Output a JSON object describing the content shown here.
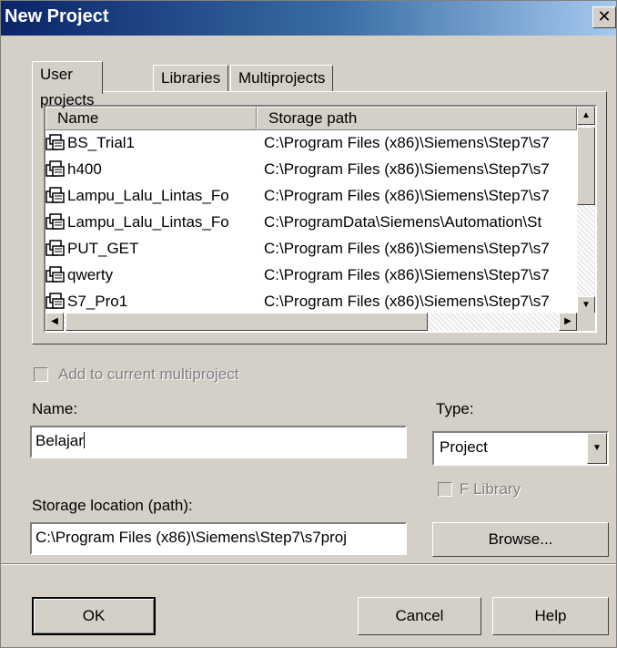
{
  "window": {
    "title": "New Project",
    "close_glyph": "✕"
  },
  "tabs": [
    {
      "label": "User projects",
      "active": true
    },
    {
      "label": "Libraries",
      "active": false
    },
    {
      "label": "Multiprojects",
      "active": false
    }
  ],
  "list": {
    "columns": [
      "Name",
      "Storage path"
    ],
    "rows": [
      {
        "name": "BS_Trial1",
        "path": "C:\\Program Files (x86)\\Siemens\\Step7\\s7"
      },
      {
        "name": "h400",
        "path": "C:\\Program Files (x86)\\Siemens\\Step7\\s7"
      },
      {
        "name": "Lampu_Lalu_Lintas_Fo",
        "path": "C:\\Program Files (x86)\\Siemens\\Step7\\s7"
      },
      {
        "name": "Lampu_Lalu_Lintas_Fo",
        "path": "C:\\ProgramData\\Siemens\\Automation\\St"
      },
      {
        "name": "PUT_GET",
        "path": "C:\\Program Files (x86)\\Siemens\\Step7\\s7"
      },
      {
        "name": "qwerty",
        "path": "C:\\Program Files (x86)\\Siemens\\Step7\\s7"
      },
      {
        "name": "S7_Pro1",
        "path": "C:\\Program Files (x86)\\Siemens\\Step7\\s7"
      }
    ],
    "icon": "project-icon"
  },
  "form": {
    "add_multiproject_label": "Add to current multiproject",
    "add_multiproject_checked": false,
    "name_label": "Name:",
    "name_value": "Belajar",
    "type_label": "Type:",
    "type_value": "Project",
    "flibrary_label": "F Library",
    "flibrary_checked": false,
    "storage_label": "Storage location (path):",
    "storage_value": "C:\\Program Files (x86)\\Siemens\\Step7\\s7proj",
    "browse_label": "Browse..."
  },
  "buttons": {
    "ok": "OK",
    "cancel": "Cancel",
    "help": "Help"
  },
  "colors": {
    "titlebar_start": "#0a246a",
    "titlebar_end": "#a6caf0",
    "face": "#d4d0c8"
  }
}
